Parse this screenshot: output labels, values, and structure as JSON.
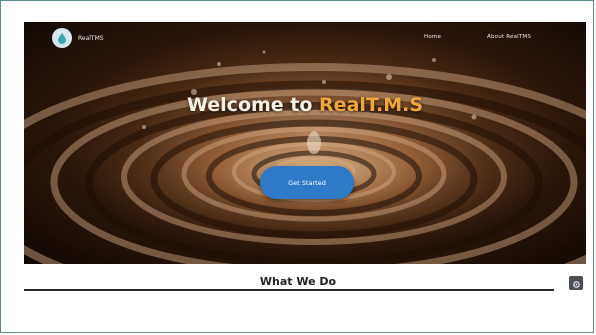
{
  "navbar": {
    "brand": "RealTMS",
    "logo_icon": "water-drop-logo-icon",
    "links": [
      "Home",
      "About RealTMS"
    ]
  },
  "hero": {
    "title_prefix": "Welcome to ",
    "title_brand": "RealT.M.S",
    "cta_label": "Get Started"
  },
  "section": {
    "title": "What We Do"
  },
  "scroll_button": {
    "icon": "gear-icon"
  },
  "colors": {
    "accent": "#f1a63a",
    "cta": "#2f79c9",
    "frame_border": "#5f8a8a"
  }
}
